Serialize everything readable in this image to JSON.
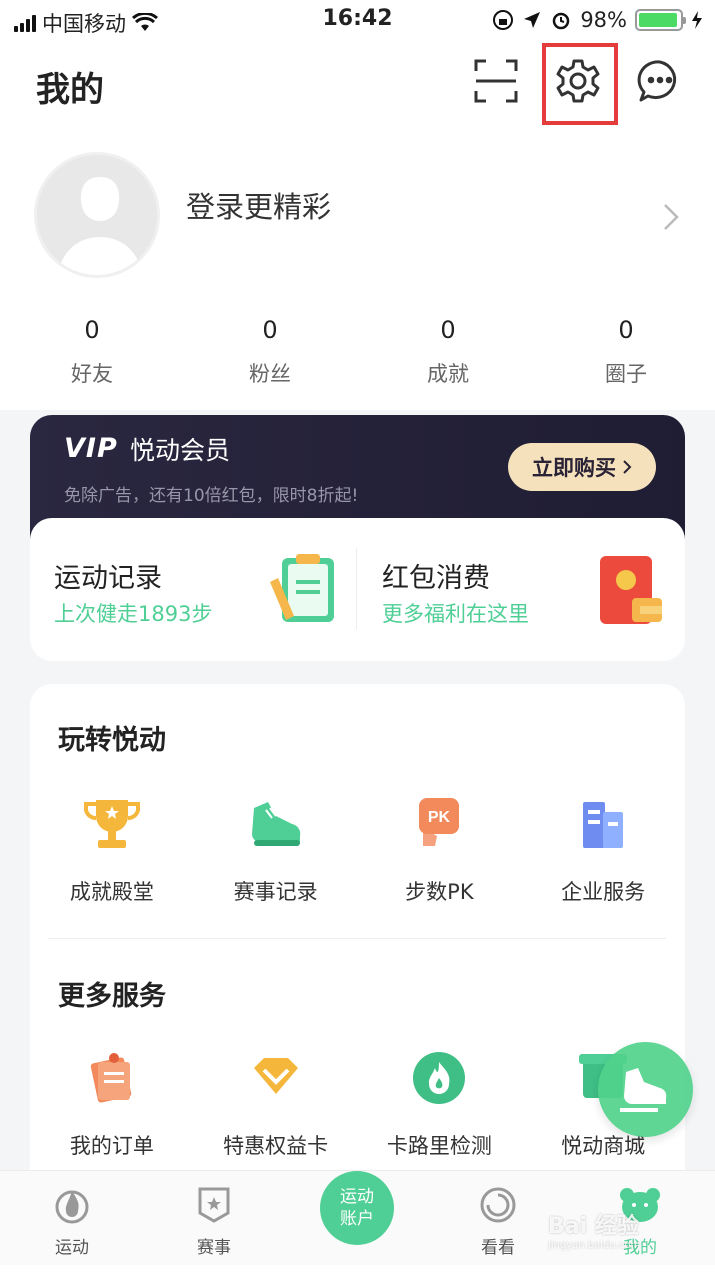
{
  "status_bar": {
    "carrier": "中国移动",
    "time": "16:42",
    "battery": "98%",
    "battery_level": 0.98
  },
  "header": {
    "title": "我的",
    "icons": [
      "scan-icon",
      "gear-icon",
      "message-icon"
    ]
  },
  "profile": {
    "login_text": "登录更精彩",
    "stats": [
      {
        "value": "0",
        "label": "好友"
      },
      {
        "value": "0",
        "label": "粉丝"
      },
      {
        "value": "0",
        "label": "成就"
      },
      {
        "value": "0",
        "label": "圈子"
      }
    ]
  },
  "vip": {
    "logo": "VIP",
    "title": "悦动会员",
    "subtitle": "免除广告，还有10倍红包，限时8折起!",
    "button": "立即购买"
  },
  "quick_cards": [
    {
      "title": "运动记录",
      "subtitle": "上次健走1893步",
      "icon": "clipboard-icon"
    },
    {
      "title": "红包消费",
      "subtitle": "更多福利在这里",
      "icon": "red-envelope-icon"
    }
  ],
  "section_play": {
    "title": "玩转悦动",
    "items": [
      {
        "label": "成就殿堂",
        "icon": "trophy-icon"
      },
      {
        "label": "赛事记录",
        "icon": "shoe-icon"
      },
      {
        "label": "步数PK",
        "icon": "pk-icon"
      },
      {
        "label": "企业服务",
        "icon": "building-icon"
      }
    ]
  },
  "section_more": {
    "title": "更多服务",
    "items": [
      {
        "label": "我的订单",
        "icon": "order-icon"
      },
      {
        "label": "特惠权益卡",
        "icon": "diamond-icon"
      },
      {
        "label": "卡路里检测",
        "icon": "flame-icon"
      },
      {
        "label": "悦动商城",
        "icon": "shop-icon"
      }
    ]
  },
  "tabbar": {
    "tabs": [
      {
        "label": "运动",
        "icon": "sport-icon"
      },
      {
        "label": "赛事",
        "icon": "badge-icon"
      },
      {
        "label": "运动账户",
        "icon": "account-icon"
      },
      {
        "label": "看看",
        "icon": "discover-icon"
      },
      {
        "label": "我的",
        "icon": "bear-icon"
      }
    ]
  },
  "watermark": {
    "text": "Bai 经验",
    "sub": "jingyan.baidu.com"
  },
  "colors": {
    "accent": "#4fcf95",
    "highlight": "#e43b3b",
    "vip_bg": "#2a2740",
    "vip_button": "#f5e2bd"
  }
}
